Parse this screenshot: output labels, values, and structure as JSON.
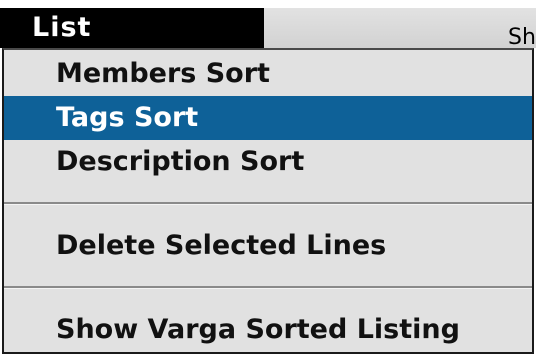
{
  "menubar": {
    "menu_title": "List",
    "clipped_text": "Sh"
  },
  "menu": {
    "items": [
      {
        "label": "Members Sort",
        "selected": false
      },
      {
        "label": "Tags Sort",
        "selected": true
      },
      {
        "label": "Description Sort",
        "selected": false
      },
      {
        "label": "Delete Selected Lines",
        "selected": false
      },
      {
        "label": "Show Varga Sorted Listing",
        "selected": false
      }
    ]
  },
  "colors": {
    "highlight": "#0e6198",
    "menu_background": "#e1e1e1",
    "menu_title_background": "#000000"
  }
}
